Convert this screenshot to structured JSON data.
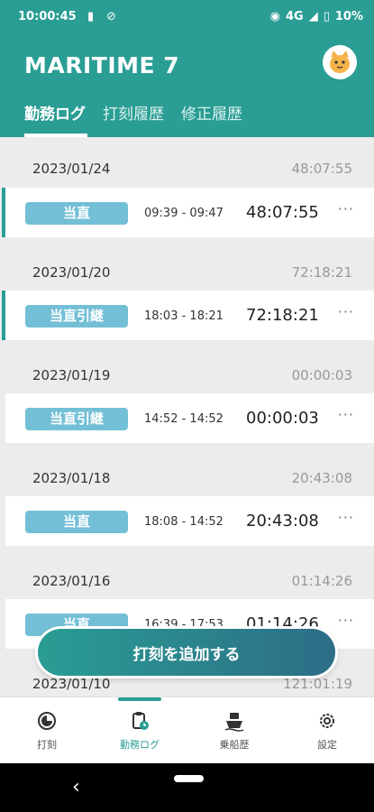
{
  "status_bar": {
    "time": "10:00:45",
    "network": "4G",
    "battery": "10%",
    "icons": [
      "sim-card-icon",
      "no-disturb-icon",
      "eye-icon",
      "signal-icon",
      "battery-icon"
    ]
  },
  "header": {
    "app_title": "MARITIME 7",
    "avatar_icon": "cat-avatar-icon",
    "tabs": [
      {
        "label": "勤務ログ",
        "active": true
      },
      {
        "label": "打刻履歴",
        "active": false
      },
      {
        "label": "修正履歴",
        "active": false
      }
    ]
  },
  "log": {
    "groups": [
      {
        "date": "2023/01/24",
        "total": "48:07:55",
        "badge": "当直",
        "range": "09:39 - 09:47",
        "duration": "48:07:55",
        "more": "···",
        "marked": true
      },
      {
        "date": "2023/01/20",
        "total": "72:18:21",
        "badge": "当直引継",
        "range": "18:03 - 18:21",
        "duration": "72:18:21",
        "more": "···",
        "marked": true
      },
      {
        "date": "2023/01/19",
        "total": "00:00:03",
        "badge": "当直引継",
        "range": "14:52 - 14:52",
        "duration": "00:00:03",
        "more": "···",
        "marked": false
      },
      {
        "date": "2023/01/18",
        "total": "20:43:08",
        "badge": "当直",
        "range": "18:08 - 14:52",
        "duration": "20:43:08",
        "more": "···",
        "marked": false
      },
      {
        "date": "2023/01/16",
        "total": "01:14:26",
        "badge": "当直",
        "range": "16:39 - 17:53",
        "duration": "01:14:26",
        "more": "···",
        "marked": false
      },
      {
        "date": "2023/01/10",
        "total": "121:01:19",
        "badge": "",
        "range": "",
        "duration": "",
        "more": "",
        "marked": false
      }
    ]
  },
  "fab": {
    "label": "打刻を追加する"
  },
  "bottom_nav": {
    "items": [
      {
        "label": "打刻",
        "icon": "clock-icon",
        "active": false
      },
      {
        "label": "勤務ログ",
        "icon": "clipboard-clock-icon",
        "active": true
      },
      {
        "label": "乗船歴",
        "icon": "ship-icon",
        "active": false
      },
      {
        "label": "設定",
        "icon": "gear-icon",
        "active": false
      }
    ]
  },
  "colors": {
    "primary": "#2a9d94",
    "badge": "#73bfd6",
    "fab_end": "#2c6d86"
  }
}
